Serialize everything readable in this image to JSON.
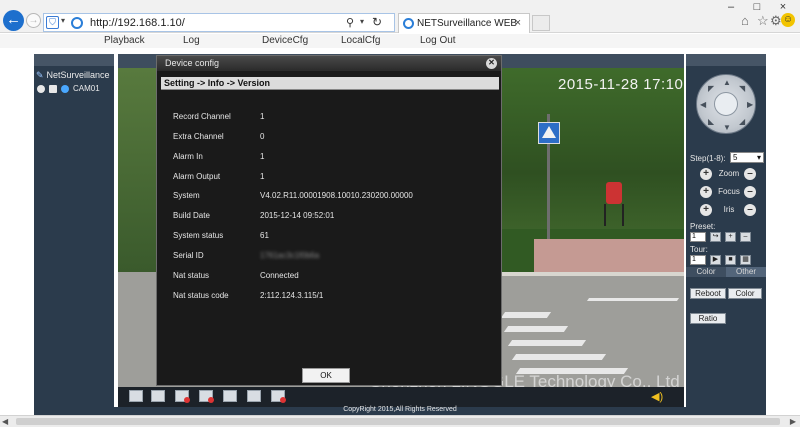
{
  "browser": {
    "address": "http://192.168.1.10/",
    "tab_title": "NETSurveillance WEB",
    "tab_close": "×",
    "window_minimize": "–",
    "window_maximize": "□",
    "window_close": "×",
    "icons": [
      "home-icon",
      "star-icon",
      "gear-icon",
      "smiley-icon"
    ]
  },
  "menu": {
    "playback": "Playback",
    "log": "Log",
    "device_cfg": "DeviceCfg",
    "local_cfg": "LocalCfg",
    "log_out": "Log Out"
  },
  "sidebar": {
    "root_label": "NetSurveillance",
    "camera_label": "CAM01"
  },
  "video": {
    "timestamp": "2015-11-28 17:10",
    "watermark": "Shenzhen LINGGLE Technology Co., Ltd"
  },
  "ptz": {
    "step_label": "Step(1-8):",
    "step_value": "5",
    "zoom": "Zoom",
    "focus": "Focus",
    "iris": "Iris",
    "preset_label": "Preset:",
    "preset_value": "1",
    "tour_label": "Tour:",
    "tour_value": "1",
    "tab_color": "Color",
    "tab_other": "Other",
    "reboot": "Reboot",
    "color": "Color",
    "ratio": "Ratio"
  },
  "footer": {
    "copyright": "CopyRight 2015,All Rights Reserved"
  },
  "dialog": {
    "title": "Device config",
    "breadcrumb": "Setting -> Info -> Version",
    "ok": "OK",
    "rows": [
      {
        "label": "Record Channel",
        "value": "1"
      },
      {
        "label": "Extra Channel",
        "value": "0"
      },
      {
        "label": "Alarm In",
        "value": "1"
      },
      {
        "label": "Alarm Output",
        "value": "1"
      },
      {
        "label": "System",
        "value": "V4.02.R11.00001908.10010.230200.00000"
      },
      {
        "label": "Build Date",
        "value": "2015-12-14 09:52:01"
      },
      {
        "label": "System status",
        "value": "61"
      },
      {
        "label": "Serial ID",
        "value": "1761ac3c1f0b6a"
      },
      {
        "label": "Nat status",
        "value": "Connected"
      },
      {
        "label": "Nat status code",
        "value": "2:112.124.3.115/1"
      }
    ]
  },
  "colors": {
    "panel": "#2b3b4c",
    "dialog_bg": "#1a1a1a",
    "accent": "#1d6fcd"
  }
}
